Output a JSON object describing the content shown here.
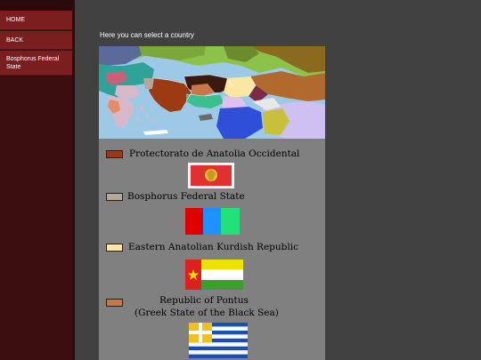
{
  "sidebar": {
    "items": [
      {
        "label": "HOME"
      },
      {
        "label": "BACK"
      },
      {
        "label": "Bosphorus Federal State"
      }
    ]
  },
  "main": {
    "prompt": "Here you can select a country"
  },
  "legend": [
    {
      "label": "Protectorato de Anatolia Occidental",
      "color": "#9c3a14"
    },
    {
      "label": "Bosphorus Federal State",
      "color": "#b5a89b"
    },
    {
      "label": "Eastern Anatolian Kurdish Republic",
      "color": "#fbe6a4"
    },
    {
      "label_line1": "Republic of Pontus",
      "label_line2": "(Greek State of the Black Sea)",
      "color": "#c87848"
    }
  ],
  "colors": {
    "sidebar_bg": "#3b0f10",
    "menu_item_bg": "#7a1e20",
    "page_bg": "#414141",
    "panel_bg": "#808080"
  }
}
